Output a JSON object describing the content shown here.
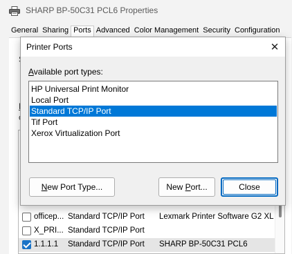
{
  "window": {
    "title": "SHARP BP-50C31 PCL6 Properties",
    "tabs": [
      "General",
      "Sharing",
      "Ports",
      "Advanced",
      "Color Management",
      "Security",
      "Configuration"
    ],
    "active_tab": "Ports",
    "fragments": [
      "S",
      "F",
      "c"
    ]
  },
  "port_table": {
    "rows": [
      {
        "checked": false,
        "port": "officep...",
        "description": "Standard TCP/IP Port",
        "printer": "Lexmark Printer Software G2 XL"
      },
      {
        "checked": false,
        "port": "X_PRI...",
        "description": "Standard TCP/IP Port",
        "printer": ""
      },
      {
        "checked": true,
        "port": "1.1.1.1",
        "description": "Standard TCP/IP Port",
        "printer": "SHARP BP-50C31 PCL6"
      }
    ]
  },
  "dialog": {
    "title": "Printer Ports",
    "close_glyph": "✕",
    "label_prefix": "",
    "label_access": "A",
    "label_rest": "vailable port types:",
    "port_types": [
      "HP Universal Print Monitor",
      "Local Port",
      "Standard TCP/IP Port",
      "Tif Port",
      "Xerox Virtualization Port"
    ],
    "selected_index": 2,
    "buttons": {
      "new_port_type": {
        "access": "N",
        "rest": "ew Port Type..."
      },
      "new_port": {
        "pre": "New ",
        "access": "P",
        "rest": "ort..."
      },
      "close": "Close"
    }
  },
  "colors": {
    "selection": "#0078d7",
    "checkbox": "#1a73c7",
    "default_button_border": "#0067c0"
  }
}
